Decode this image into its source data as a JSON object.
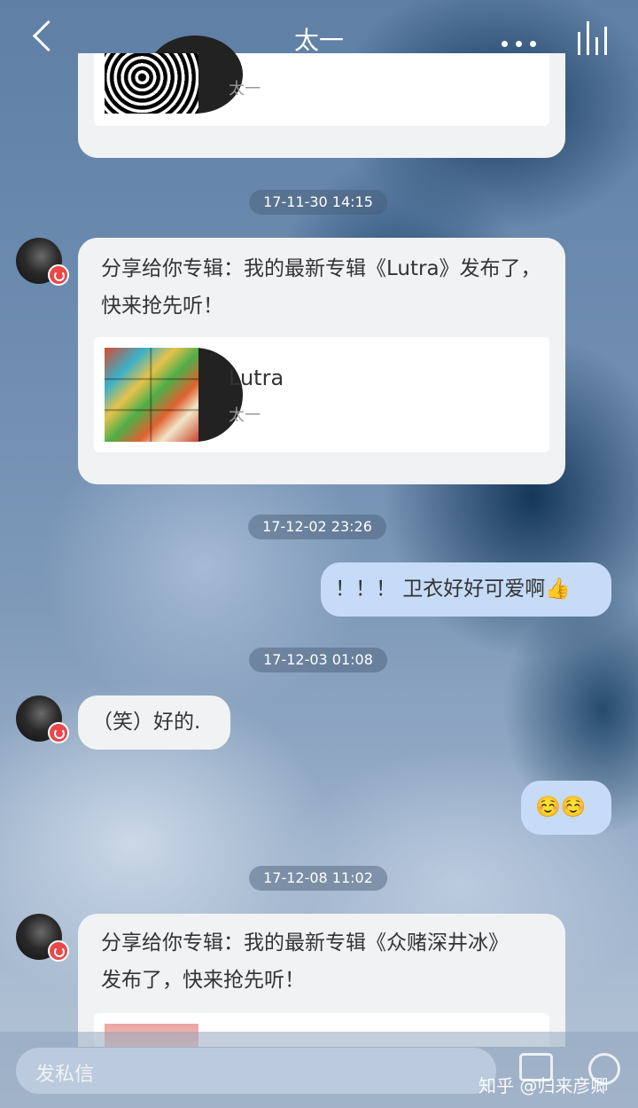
{
  "header": {
    "title": "太一"
  },
  "partial_card_top": {
    "artist": "太一"
  },
  "timestamps": [
    "17-11-30 14:15",
    "17-12-02 23:26",
    "17-12-03 01:08",
    "17-12-08 11:02"
  ],
  "messages": [
    {
      "side": "left",
      "text": "分享给你专辑：我的最新专辑《Lutra》发布了，快来抢先听！",
      "album": {
        "name": "Lutra",
        "artist": "太一"
      }
    },
    {
      "side": "right",
      "text": "！！！ 卫衣好好可爱啊👍"
    },
    {
      "side": "left",
      "text": "（笑）好的."
    },
    {
      "side": "right",
      "text": "☺️☺️"
    },
    {
      "side": "left",
      "text": "分享给你专辑：我的最新专辑《众赌深井冰》发布了，快来抢先听！"
    }
  ],
  "input": {
    "placeholder": "发私信"
  },
  "watermark": "知乎 @归来彦卿",
  "icons": [
    "back-arrow-icon",
    "more-icon",
    "now-playing-icon",
    "image-icon",
    "emoji-icon",
    "avatar-badge-icon"
  ],
  "colors": {
    "bubble_left": "#f1f2f4",
    "bubble_right": "#c6dbf7",
    "badge": "#e8484a"
  }
}
